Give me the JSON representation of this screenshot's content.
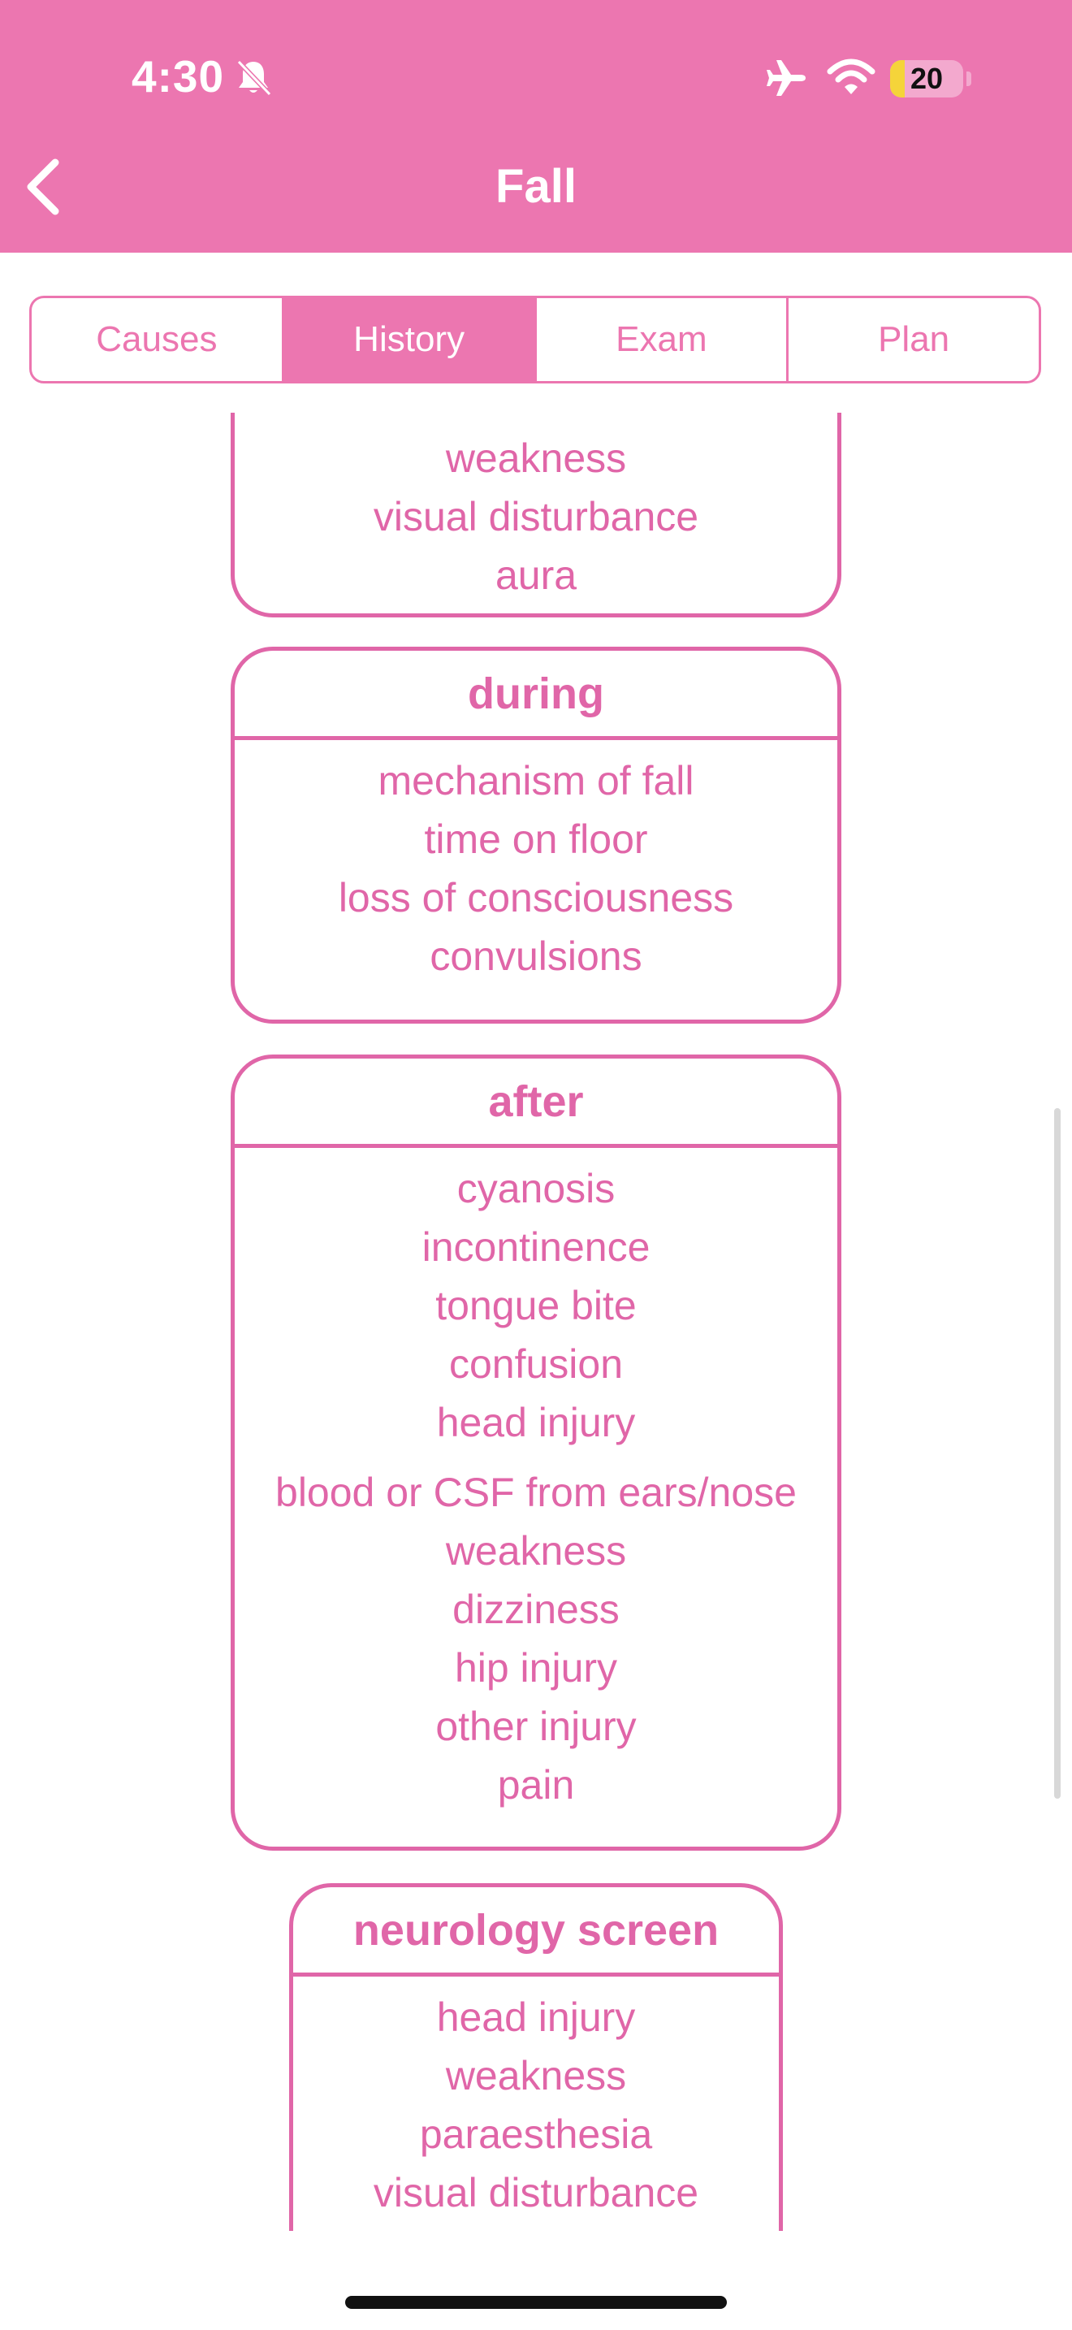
{
  "status_bar": {
    "time": "4:30",
    "battery": "20",
    "battery_level": 0.2,
    "icons": [
      "bell-slash-icon",
      "airplane-icon",
      "wifi-icon",
      "battery-icon"
    ]
  },
  "nav": {
    "title": "Fall",
    "back_icon": "chevron-left-icon"
  },
  "tabs": [
    {
      "label": "Causes",
      "active": false
    },
    {
      "label": "History",
      "active": true
    },
    {
      "label": "Exam",
      "active": false
    },
    {
      "label": "Plan",
      "active": false
    }
  ],
  "sections": {
    "before": {
      "items": [
        "weakness",
        "visual disturbance",
        "aura"
      ]
    },
    "during": {
      "title": "during",
      "items": [
        "mechanism of fall",
        "time on floor",
        "loss of consciousness",
        "convulsions"
      ]
    },
    "after": {
      "title": "after",
      "items": [
        "cyanosis",
        "incontinence",
        "tongue bite",
        "confusion",
        "head injury",
        "blood or CSF from ears/nose",
        "weakness",
        "dizziness",
        "hip injury",
        "other injury",
        "pain"
      ]
    },
    "neurology": {
      "title": "neurology screen",
      "items": [
        "head injury",
        "weakness",
        "paraesthesia",
        "visual disturbance"
      ]
    }
  },
  "colors": {
    "accent": "#ec76b0",
    "text": "#e066a8",
    "background": "#ffffff"
  }
}
